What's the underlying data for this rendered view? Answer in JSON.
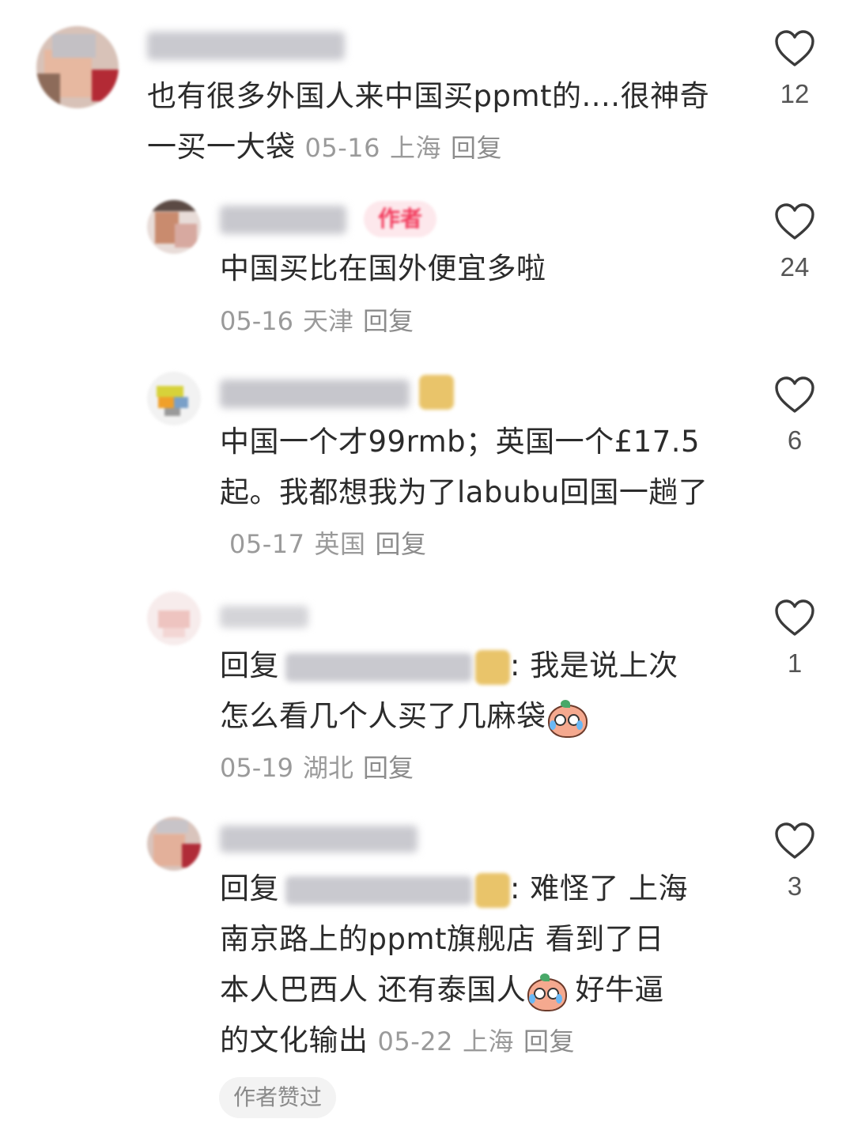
{
  "comments": [
    {
      "text": "也有很多外国人来中国买ppmt的....很神奇 一买一大袋",
      "date": "05-16",
      "location": "上海",
      "reply_label": "回复",
      "likes": "12"
    },
    {
      "author_badge": "作者",
      "text": "中国买比在国外便宜多啦",
      "date": "05-16",
      "location": "天津",
      "reply_label": "回复",
      "likes": "24"
    },
    {
      "text": "中国一个才99rmb；英国一个£17.5起。我都想我为了labubu回国一趟了",
      "date": "05-17",
      "location": "英国",
      "reply_label": "回复",
      "likes": "6"
    },
    {
      "reply_prefix": "回复",
      "text_a": ": 我是说上次",
      "text_b": "怎么看几个人买了几麻袋",
      "date": "05-19",
      "location": "湖北",
      "reply_label": "回复",
      "likes": "1"
    },
    {
      "reply_prefix": "回复",
      "text_a": ": 难怪了 上海",
      "text_b": "南京路上的ppmt旗舰店 看到了日",
      "text_c": "本人巴西人 还有泰国人",
      "text_d": "好牛逼",
      "text_e": "的文化输出",
      "date": "05-22",
      "location": "上海",
      "reply_label": "回复",
      "likes": "3",
      "author_liked": "作者赞过"
    }
  ],
  "colors": {
    "text": "#2b2b2b",
    "meta": "#9a9a9a",
    "author_tag_bg": "#fde8ec",
    "author_tag_text": "#f2395b"
  },
  "icons": [
    "heart-outline-icon",
    "loudly-crying-emoji-icon"
  ]
}
